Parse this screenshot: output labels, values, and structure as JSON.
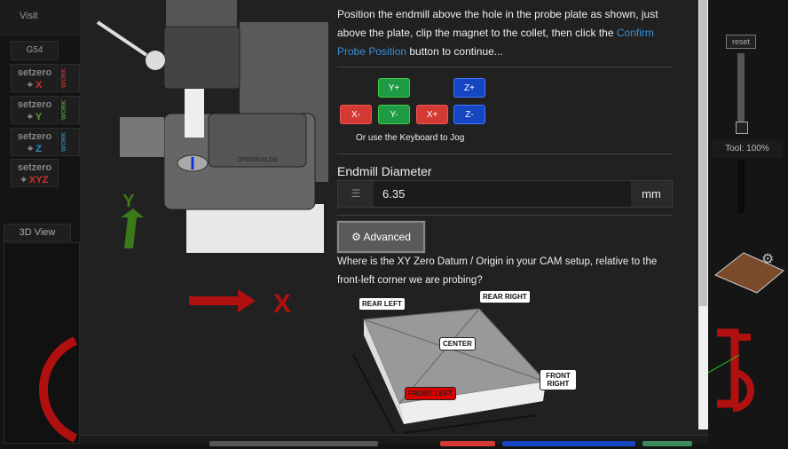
{
  "background": {
    "visit_label": "Visit",
    "wcs": "G54",
    "setzero": [
      {
        "label": "setzero",
        "axis": "X",
        "color": "#d03030"
      },
      {
        "label": "setzero",
        "axis": "Y",
        "color": "#5aa030"
      },
      {
        "label": "setzero",
        "axis": "Z",
        "color": "#2a8ad0"
      },
      {
        "label": "setzero",
        "axis": "XYZ",
        "color": "#d03030"
      }
    ],
    "work_label": "WORK",
    "view_tab": "3D View",
    "reset_label": "reset",
    "tool_label": "Tool: 100%"
  },
  "modal": {
    "instructions_pre": "Position the endmill above the hole in the probe plate as shown, just above the plate, clip the magnet to the collet, then click the ",
    "instructions_link": "Confirm Probe Position",
    "instructions_post": " button to continue...",
    "jog": {
      "y_plus": "Y+",
      "y_minus": "Y-",
      "x_minus": "X-",
      "x_plus": "X+",
      "z_plus": "Z+",
      "z_minus": "Z-",
      "hint": "Or use the Keyboard to Jog"
    },
    "endmill": {
      "label": "Endmill Diameter",
      "value": "6.35",
      "unit": "mm"
    },
    "advanced_label": "Advanced",
    "datum_question": "Where is the XY Zero Datum / Origin in your CAM setup, relative to the front-left corner we are probing?",
    "datum_options": {
      "rear_left": "REAR LEFT",
      "rear_right": "REAR RIGHT",
      "center": "CENTER",
      "front_right": "FRONT RIGHT",
      "front_left": "FRONT LEFT"
    },
    "selected_datum": "FRONT LEFT",
    "illustration": {
      "brand": "OPENBUILDS",
      "y_axis": "Y",
      "x_axis": "X"
    }
  }
}
